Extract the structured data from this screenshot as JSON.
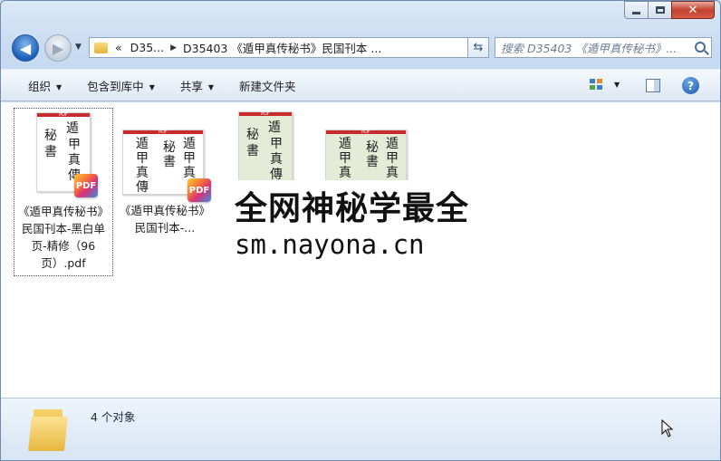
{
  "window": {
    "close_symbol": "✕"
  },
  "address": {
    "crumb_parent": "D35...",
    "crumb_current": "D35403 《遁甲真传秘书》民国刊本 ...",
    "overflow": "«"
  },
  "search": {
    "placeholder": "搜索 D35403 《遁甲真传秘书》..."
  },
  "toolbar": {
    "organize": "组织",
    "include_library": "包含到库中",
    "share": "共享",
    "new_folder": "新建文件夹"
  },
  "files": [
    {
      "name": "《遁甲真传秘书》民国刊本-黑白单页-精修（96页）.pdf",
      "badge": "PDF",
      "thumb_glyphs": [
        "遁",
        "甲",
        "真",
        "傳",
        "秘",
        "書"
      ]
    },
    {
      "name": "《遁甲真传秘书》民国刊本-...",
      "badge": "PDF",
      "thumb_glyphs": [
        "遁",
        "甲",
        "真",
        "傳",
        "秘",
        "書",
        "遁",
        "甲",
        "真",
        "傳"
      ]
    },
    {
      "name": "",
      "badge": "",
      "thumb_glyphs": [
        "遁",
        "甲",
        "真",
        "傳",
        "秘",
        "書"
      ]
    },
    {
      "name": "",
      "badge": "",
      "thumb_glyphs": [
        "遁",
        "甲",
        "真",
        "傳",
        "秘",
        "書",
        "遁",
        "甲",
        "真",
        "傳"
      ]
    }
  ],
  "thumb_header": "PDF",
  "watermark": {
    "line1": "全网神秘学最全",
    "line2": "sm.nayona.cn"
  },
  "status": {
    "count": "4 个对象"
  },
  "icons": {
    "back": "arrow-left-icon",
    "forward": "arrow-right-icon",
    "refresh": "refresh-icon",
    "search": "search-icon",
    "help": "help-icon",
    "folder": "folder-icon"
  }
}
